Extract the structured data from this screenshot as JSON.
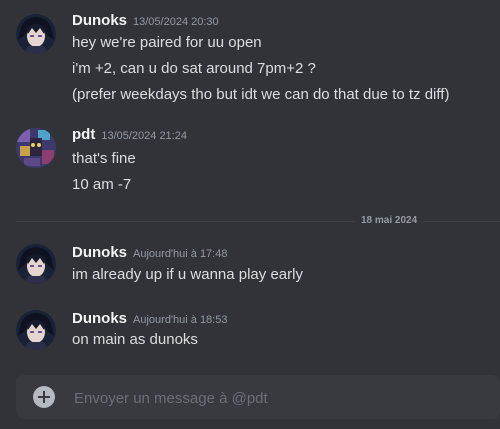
{
  "messages": [
    {
      "author": "Dunoks",
      "timestamp": "13/05/2024 20:30",
      "lines": [
        "hey we're paired for uu open",
        "i'm +2, can u do sat around 7pm+2 ?",
        "(prefer weekdays tho but idt we can do that due to tz diff)"
      ]
    },
    {
      "author": "pdt",
      "timestamp": "13/05/2024 21:24",
      "lines": [
        "that's fine",
        "10 am -7"
      ]
    },
    {
      "author": "Dunoks",
      "timestamp": "Aujourd'hui à 17:48",
      "lines": [
        "im already up if u wanna play early"
      ]
    },
    {
      "author": "Dunoks",
      "timestamp": "Aujourd'hui à 18:53",
      "lines": [
        "on main as dunoks"
      ]
    }
  ],
  "date_divider": "18 mai 2024",
  "composer": {
    "placeholder": "Envoyer un message à @pdt"
  },
  "colors": {
    "background": "#313338",
    "composer_bg": "#383a40",
    "username": "#f2f3f5",
    "timestamp": "#949ba4",
    "text": "#dbdee1"
  }
}
